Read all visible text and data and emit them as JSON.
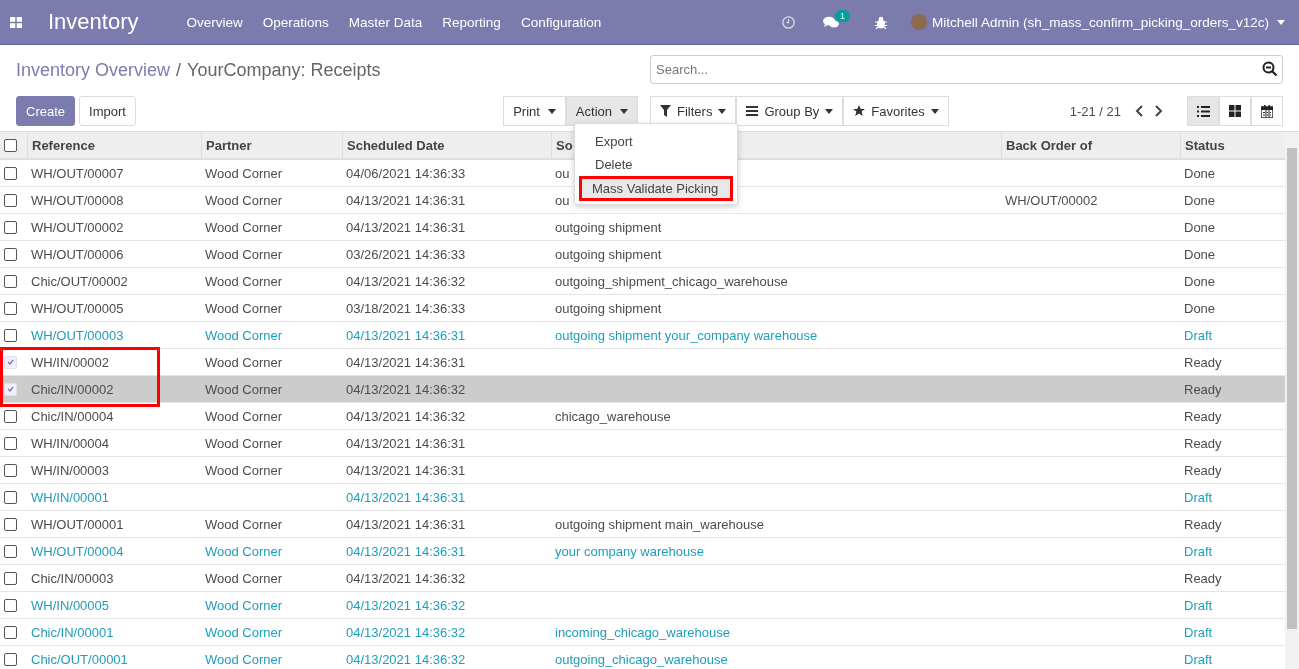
{
  "navbar": {
    "app_name": "Inventory",
    "menu": [
      "Overview",
      "Operations",
      "Master Data",
      "Reporting",
      "Configuration"
    ],
    "message_count": "1",
    "user": "Mitchell Admin (sh_mass_confirm_picking_orders_v12c)"
  },
  "breadcrumb": {
    "parent": "Inventory Overview",
    "separator": "/",
    "current": "YourCompany: Receipts"
  },
  "buttons": {
    "create": "Create",
    "import": "Import"
  },
  "dropdowns": [
    {
      "label": "Print",
      "selected": false
    },
    {
      "label": "Action",
      "selected": true
    }
  ],
  "search": {
    "placeholder": "Search..."
  },
  "filters": [
    {
      "kind": "filter",
      "label": "Filters"
    },
    {
      "kind": "group",
      "label": "Group By"
    },
    {
      "kind": "favorite",
      "label": "Favorites"
    }
  ],
  "pager": "1-21 / 21",
  "views": [
    {
      "kind": "list",
      "selected": true
    },
    {
      "kind": "kanban",
      "selected": false
    },
    {
      "kind": "calendar",
      "selected": false
    }
  ],
  "action_menu": [
    {
      "label": "Export",
      "highlighted": false
    },
    {
      "label": "Delete",
      "highlighted": false
    },
    {
      "label": "Mass Validate Picking",
      "highlighted": true
    }
  ],
  "table": {
    "selection_outlined": true,
    "all_selected": false,
    "columns": [
      "Reference",
      "Partner",
      "Scheduled Date",
      "So",
      "Back Order of",
      "Status"
    ],
    "rows": [
      {
        "reference": "WH/OUT/00007",
        "partner": "Wood Corner",
        "scheduled_date": "04/06/2021 14:36:33",
        "column_4": "ou",
        "status": "Done",
        "selected": false,
        "hovered": false,
        "color": "#4c4c4c"
      },
      {
        "reference": "WH/OUT/00008",
        "partner": "Wood Corner",
        "scheduled_date": "04/13/2021 14:36:31",
        "column_4": "ou",
        "back_order_of": "WH/OUT/00002",
        "status": "Done",
        "selected": false,
        "hovered": false,
        "color": "#4c4c4c"
      },
      {
        "reference": "WH/OUT/00002",
        "partner": "Wood Corner",
        "scheduled_date": "04/13/2021 14:36:31",
        "column_4": "outgoing shipment",
        "status": "Done",
        "selected": false,
        "hovered": false,
        "color": "#4c4c4c"
      },
      {
        "reference": "WH/OUT/00006",
        "partner": "Wood Corner",
        "scheduled_date": "03/26/2021 14:36:33",
        "column_4": "outgoing shipment",
        "status": "Done",
        "selected": false,
        "hovered": false,
        "color": "#4c4c4c"
      },
      {
        "reference": "Chic/OUT/00002",
        "partner": "Wood Corner",
        "scheduled_date": "04/13/2021 14:36:32",
        "column_4": "outgoing_shipment_chicago_warehouse",
        "status": "Done",
        "selected": false,
        "hovered": false,
        "color": "#4c4c4c"
      },
      {
        "reference": "WH/OUT/00005",
        "partner": "Wood Corner",
        "scheduled_date": "03/18/2021 14:36:33",
        "column_4": "outgoing shipment",
        "status": "Done",
        "selected": false,
        "hovered": false,
        "color": "#4c4c4c"
      },
      {
        "reference": "WH/OUT/00003",
        "partner": "Wood Corner",
        "scheduled_date": "04/13/2021 14:36:31",
        "column_4": "outgoing shipment your_company warehouse",
        "status": "Draft",
        "selected": false,
        "hovered": false,
        "color": "#1f9dba"
      },
      {
        "reference": "WH/IN/00002",
        "partner": "Wood Corner",
        "scheduled_date": "04/13/2021 14:36:31",
        "status": "Ready",
        "selected": true,
        "hovered": false,
        "color": "#4c4c4c"
      },
      {
        "reference": "Chic/IN/00002",
        "partner": "Wood Corner",
        "scheduled_date": "04/13/2021 14:36:32",
        "status": "Ready",
        "selected": true,
        "hovered": true,
        "color": "#4c4c4c"
      },
      {
        "reference": "Chic/IN/00004",
        "partner": "Wood Corner",
        "scheduled_date": "04/13/2021 14:36:32",
        "column_4": "chicago_warehouse",
        "status": "Ready",
        "selected": false,
        "hovered": false,
        "color": "#4c4c4c"
      },
      {
        "reference": "WH/IN/00004",
        "partner": "Wood Corner",
        "scheduled_date": "04/13/2021 14:36:31",
        "status": "Ready",
        "selected": false,
        "hovered": false,
        "color": "#4c4c4c"
      },
      {
        "reference": "WH/IN/00003",
        "partner": "Wood Corner",
        "scheduled_date": "04/13/2021 14:36:31",
        "status": "Ready",
        "selected": false,
        "hovered": false,
        "color": "#4c4c4c"
      },
      {
        "reference": "WH/IN/00001",
        "scheduled_date": "04/13/2021 14:36:31",
        "status": "Draft",
        "selected": false,
        "hovered": false,
        "color": "#1f9dba"
      },
      {
        "reference": "WH/OUT/00001",
        "partner": "Wood Corner",
        "scheduled_date": "04/13/2021 14:36:31",
        "column_4": "outgoing shipment main_warehouse",
        "status": "Ready",
        "selected": false,
        "hovered": false,
        "color": "#4c4c4c"
      },
      {
        "reference": "WH/OUT/00004",
        "partner": "Wood Corner",
        "scheduled_date": "04/13/2021 14:36:31",
        "column_4": "your company warehouse",
        "status": "Draft",
        "selected": false,
        "hovered": false,
        "color": "#1f9dba"
      },
      {
        "reference": "Chic/IN/00003",
        "partner": "Wood Corner",
        "scheduled_date": "04/13/2021 14:36:32",
        "status": "Ready",
        "selected": false,
        "hovered": false,
        "color": "#4c4c4c"
      },
      {
        "reference": "WH/IN/00005",
        "partner": "Wood Corner",
        "scheduled_date": "04/13/2021 14:36:32",
        "status": "Draft",
        "selected": false,
        "hovered": false,
        "color": "#1f9dba"
      },
      {
        "reference": "Chic/IN/00001",
        "partner": "Wood Corner",
        "scheduled_date": "04/13/2021 14:36:32",
        "column_4": "incoming_chicago_warehouse",
        "status": "Draft",
        "selected": false,
        "hovered": false,
        "color": "#1f9dba"
      },
      {
        "reference": "Chic/OUT/00001",
        "partner": "Wood Corner",
        "scheduled_date": "04/13/2021 14:36:32",
        "column_4": "outgoing_chicago_warehouse",
        "status": "Draft",
        "selected": false,
        "hovered": false,
        "color": "#1f9dba"
      }
    ]
  }
}
